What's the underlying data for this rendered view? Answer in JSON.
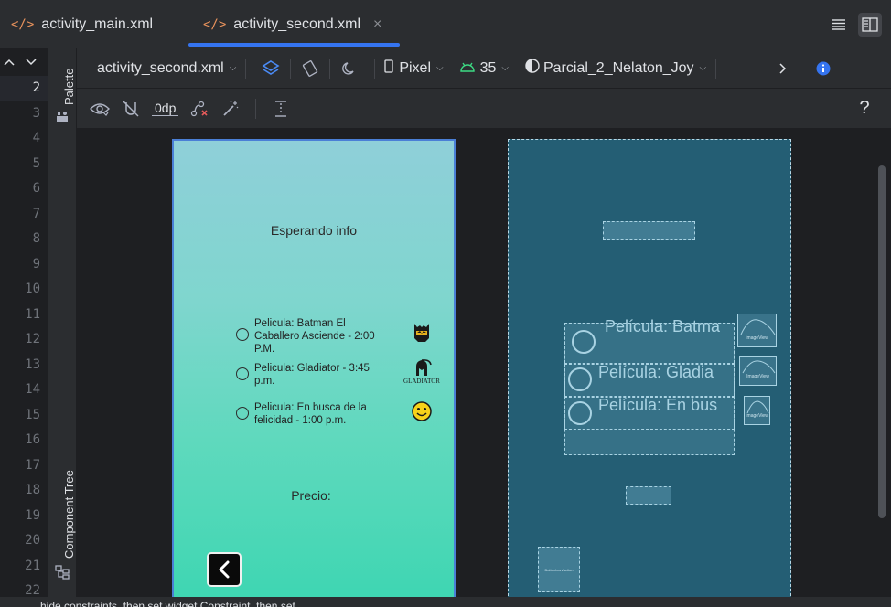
{
  "tabs": [
    {
      "label": "activity_main.xml"
    },
    {
      "label": "activity_second.xml",
      "close": "×"
    }
  ],
  "tab_right_icons": [
    "menu-icon",
    "split-view-icon"
  ],
  "gutter": {
    "lines": [
      "2",
      "3",
      "4",
      "5",
      "6",
      "7",
      "8",
      "9",
      "10",
      "11",
      "12",
      "13",
      "14",
      "15",
      "16",
      "17",
      "18",
      "19",
      "20",
      "21",
      "22"
    ]
  },
  "side": {
    "palette": "Palette",
    "component_tree": "Component Tree"
  },
  "toolbar": {
    "file": "activity_second.xml",
    "device": "Pixel",
    "api": "35",
    "theme": "Parcial_2_Nelaton_Joy",
    "margin": "0dp",
    "help": "?"
  },
  "design": {
    "waiting": "Esperando info",
    "options": [
      {
        "label": "Pelicula: Batman El Caballero Asciende - 2:00 P.M.",
        "icon": "batman-icon"
      },
      {
        "label": "Pelicula: Gladiator - 3:45 p.m.",
        "icon": "gladiator-helmet-icon",
        "caption": "GLADIATOR"
      },
      {
        "label": "Pelicula: En busca de la felicidad - 1:00 p.m.",
        "icon": "smiley-icon"
      }
    ],
    "price": "Precio:"
  },
  "blueprint": {
    "options": [
      "Película: Batma",
      "Película: Gladia",
      "Película: En bus"
    ],
    "image_caption": "ImageView",
    "button_caption": "ButtonIcon/action"
  },
  "status": {
    "text": "...hide constraints, then set widget Constraint, then set"
  },
  "colors": {
    "accent": "#3574f0",
    "xml": "#e8925c",
    "android": "#3ddc84",
    "info": "#3574f0"
  }
}
